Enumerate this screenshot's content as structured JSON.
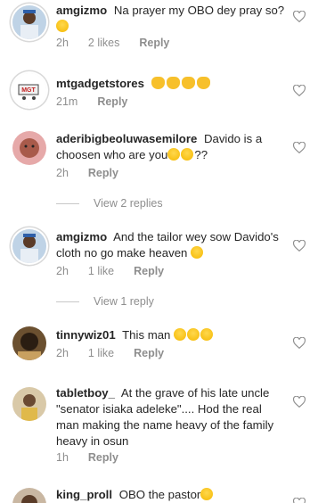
{
  "comments": [
    {
      "username": "amgizmo",
      "text": "Na prayer my OBO dey pray so?",
      "emojis": "😂",
      "time": "2h",
      "likes": "2 likes",
      "reply": "Reply"
    },
    {
      "username": "mtgadgetstores",
      "text": "",
      "emojis": "👏👏👏👏",
      "time": "21m",
      "reply": "Reply"
    },
    {
      "username": "aderibigbeoluwasemilore",
      "text": "Davido is a choosen who are you",
      "emojis": "😂😂??",
      "time": "2h",
      "reply": "Reply"
    },
    {
      "view_replies": "View 2 replies"
    },
    {
      "username": "amgizmo",
      "text": "And the tailor wey sow Davido's cloth no go make heaven",
      "emojis": "😂",
      "time": "2h",
      "likes": "1 like",
      "reply": "Reply"
    },
    {
      "view_replies": "View 1 reply"
    },
    {
      "username": "tinnywiz01",
      "text": "This man",
      "emojis": "😂😂😂",
      "time": "2h",
      "likes": "1 like",
      "reply": "Reply"
    },
    {
      "username": "tabletboy_",
      "text": "At the grave of his late uncle \"senator isiaka adeleke\".... Hod the real man making the name heavy of the family heavy in osun",
      "time": "1h",
      "reply": "Reply"
    },
    {
      "username": "king_proll",
      "text": "OBO the pastor",
      "emojis": "😂"
    }
  ]
}
